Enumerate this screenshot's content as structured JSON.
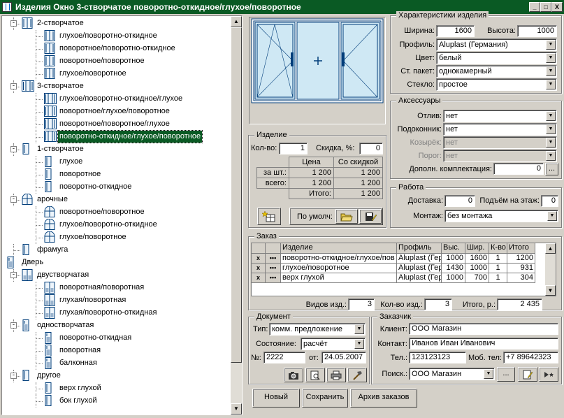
{
  "window": {
    "title": "Изделия Окно 3-створчатое поворотно-откидное/глухое/поворотное",
    "minimize": "_",
    "maximize": "□",
    "close": "X"
  },
  "tree": {
    "nodes": [
      {
        "label": "2-створчатое",
        "level": 1,
        "toggle": "-",
        "icon": "window-2-icon"
      },
      {
        "label": "глухое/поворотно-откидное",
        "level": 2,
        "icon": "window-2-icon"
      },
      {
        "label": "поворотное/поворотно-откидное",
        "level": 2,
        "icon": "window-2-icon"
      },
      {
        "label": "поворотное/поворотное",
        "level": 2,
        "icon": "window-2-icon"
      },
      {
        "label": "глухое/поворотное",
        "level": 2,
        "icon": "window-2-icon"
      },
      {
        "label": "3-створчатое",
        "level": 1,
        "toggle": "-",
        "icon": "window-3-icon"
      },
      {
        "label": "глухое/поворотно-откидное/глухое",
        "level": 2,
        "icon": "window-3-icon"
      },
      {
        "label": "поворотное/глухое/поворотное",
        "level": 2,
        "icon": "window-3-icon"
      },
      {
        "label": "поворотное/поворотное/глухое",
        "level": 2,
        "icon": "window-3-icon"
      },
      {
        "label": "поворотно-откидное/глухое/поворотное",
        "level": 2,
        "icon": "window-3-icon",
        "selected": true
      },
      {
        "label": "1-створчатое",
        "level": 1,
        "toggle": "-",
        "icon": "window-1-icon"
      },
      {
        "label": "глухое",
        "level": 2,
        "icon": "window-1-icon"
      },
      {
        "label": "поворотное",
        "level": 2,
        "icon": "window-1-icon"
      },
      {
        "label": "поворотно-откидное",
        "level": 2,
        "icon": "window-1-icon"
      },
      {
        "label": "арочные",
        "level": 1,
        "toggle": "-",
        "icon": "arch-window-icon"
      },
      {
        "label": "поворотное/поворотное",
        "level": 2,
        "icon": "arch-window-icon"
      },
      {
        "label": "глухое/поворотно-откидное",
        "level": 2,
        "icon": "arch-window-icon"
      },
      {
        "label": "глухое/поворотное",
        "level": 2,
        "icon": "arch-window-icon"
      },
      {
        "label": "фрамуга",
        "level": 1,
        "icon": "window-1-icon"
      },
      {
        "label": "Дверь",
        "level": 0,
        "toggle": "-",
        "icon": "door-icon"
      },
      {
        "label": "двустворчатая",
        "level": 1,
        "toggle": "-",
        "icon": "door-double-icon"
      },
      {
        "label": "поворотная/поворотная",
        "level": 2,
        "icon": "door-double-icon"
      },
      {
        "label": "глухая/поворотная",
        "level": 2,
        "icon": "door-double-icon"
      },
      {
        "label": "глухая/поворотно-откидная",
        "level": 2,
        "icon": "door-double-icon"
      },
      {
        "label": "одностворчатая",
        "level": 1,
        "toggle": "-",
        "icon": "door-icon"
      },
      {
        "label": "поворотно-откидная",
        "level": 2,
        "icon": "door-icon"
      },
      {
        "label": "поворотная",
        "level": 2,
        "icon": "door-icon"
      },
      {
        "label": "балконная",
        "level": 2,
        "icon": "door-icon"
      },
      {
        "label": "другое",
        "level": 1,
        "toggle": "-",
        "icon": "window-1-icon"
      },
      {
        "label": "верх глухой",
        "level": 2,
        "icon": "window-1-icon"
      },
      {
        "label": "бок глухой",
        "level": 2,
        "icon": "window-1-icon"
      }
    ]
  },
  "characteristics": {
    "title": "Характеристики изделия",
    "width_label": "Ширина:",
    "width": "1600",
    "height_label": "Высота:",
    "height": "1000",
    "profile_label": "Профиль:",
    "profile": "Aluplast (Германия)",
    "color_label": "Цвет:",
    "color": "белый",
    "glass_pack_label": "Ст. пакет:",
    "glass_pack": "однокамерный",
    "glass_label": "Стекло:",
    "glass": "простое"
  },
  "accessories": {
    "title": "Аксессуары",
    "otliv_label": "Отлив:",
    "otliv": "нет",
    "sill_label": "Подоконник:",
    "sill": "нет",
    "kozyrek_label": "Козырёк:",
    "kozyrek": "нет",
    "porog_label": "Порог:",
    "porog": "нет",
    "extra_label": "Дополн. комплектация:",
    "extra": "0",
    "extra_btn": "..."
  },
  "work": {
    "title": "Работа",
    "delivery_label": "Доставка:",
    "delivery": "0",
    "floor_label": "Подъём на этаж:",
    "floor": "0",
    "mount_label": "Монтаж:",
    "mount": "без монтажа"
  },
  "product": {
    "title": "Изделие",
    "qty_label": "Кол-во:",
    "qty": "1",
    "discount_label": "Скидка, %:",
    "discount": "0",
    "price_header": "Цена",
    "discount_header": "Со скидкой",
    "per_unit_label": "за шт.:",
    "per_unit_price": "1 200",
    "per_unit_disc": "1 200",
    "total_label": "всего:",
    "total_price": "1 200",
    "total_disc": "1 200",
    "itogo_label": "Итого:",
    "itogo": "1 200",
    "default_label": "По умолч:"
  },
  "order": {
    "title": "Заказ",
    "columns": [
      "Изделие",
      "Профиль",
      "Выс.",
      "Шир.",
      "К-во",
      "Итого"
    ],
    "rows": [
      {
        "name": "поворотно-откидное/глухое/пов",
        "profile": "Aluplast (Гер",
        "h": "1000",
        "w": "1600",
        "qty": "1",
        "total": "1200"
      },
      {
        "name": "глухое/поворотное",
        "profile": "Aluplast (Гер",
        "h": "1430",
        "w": "1000",
        "qty": "1",
        "total": "931"
      },
      {
        "name": "верх глухой",
        "profile": "Aluplast (Гер",
        "h": "1000",
        "w": "700",
        "qty": "1",
        "total": "304"
      }
    ],
    "row_delete": "x",
    "row_more": "•••",
    "kinds_label": "Видов изд.:",
    "kinds": "3",
    "count_label": "Кол-во изд.:",
    "count": "3",
    "total_label": "Итого, р.:",
    "total": "2 435"
  },
  "document": {
    "title": "Документ",
    "type_label": "Тип:",
    "type": "комм. предложение",
    "state_label": "Состояние:",
    "state": "расчёт",
    "number_label": "№:",
    "number": "2222",
    "date_label": "от:",
    "date": "24.05.2007"
  },
  "customer": {
    "title": "Заказчик",
    "client_label": "Клиент:",
    "client": "ООО Магазин",
    "contact_label": "Контакт:",
    "contact": "Иванов Иван Иванович",
    "phone_label": "Тел.:",
    "phone": "123123123",
    "mobile_label": "Моб. тел:",
    "mobile": "+7 89642323",
    "search_label": "Поиск.:",
    "search": "ООО Магазин",
    "search_btn": "..."
  },
  "actions": {
    "new": "Новый",
    "save": "Сохранить",
    "archive": "Архив заказов"
  },
  "colors": {
    "title_bar": "#0a5a24",
    "selection": "#0a5a24",
    "frame": "#003d7a",
    "glass": "#cfe8f4"
  }
}
